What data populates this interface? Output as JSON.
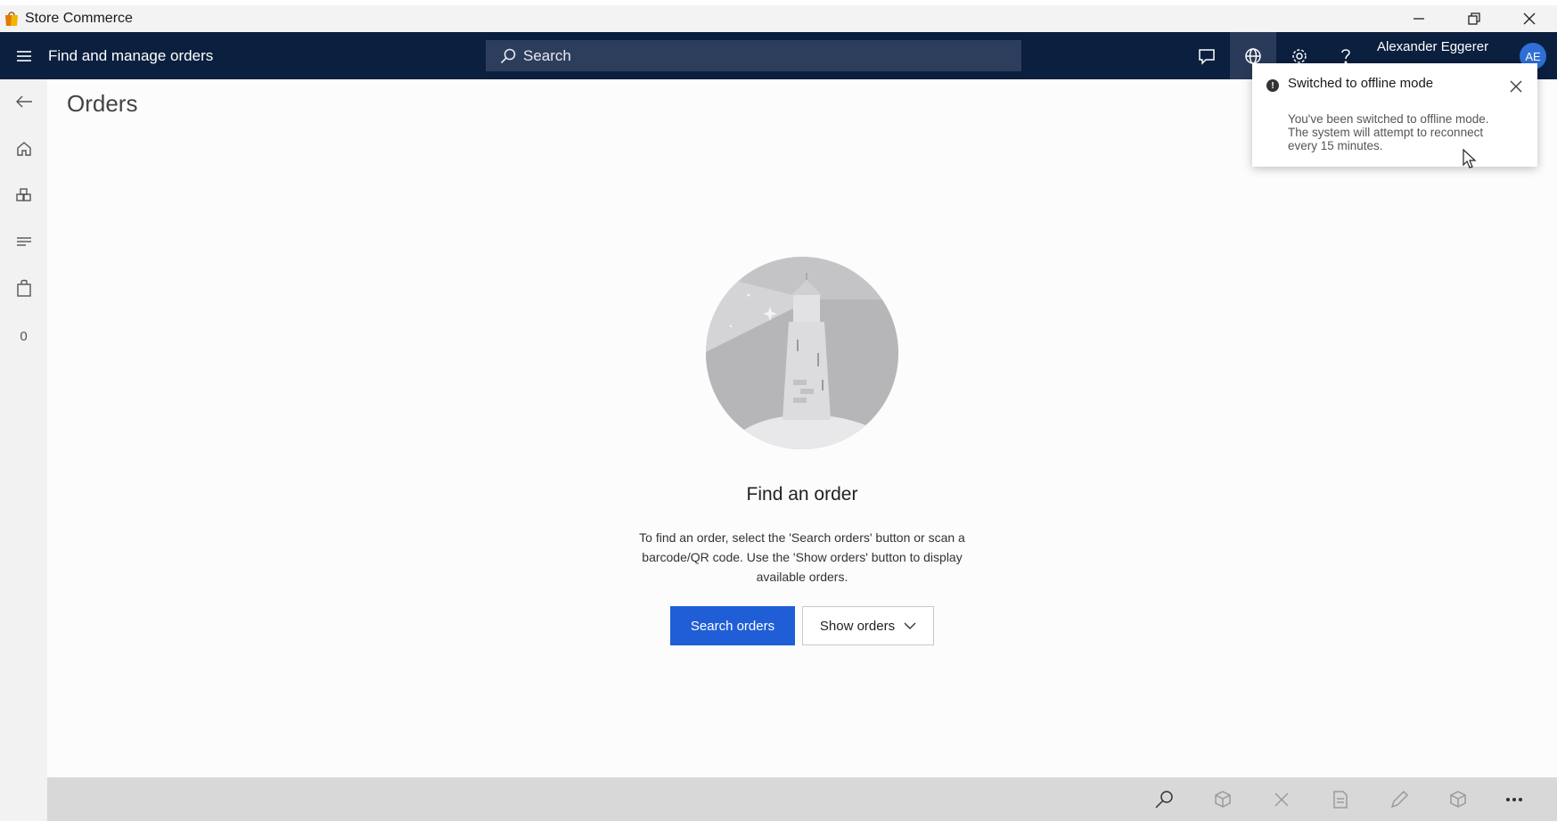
{
  "window": {
    "app_title": "Store Commerce",
    "logo_icon": "store-bag-icon",
    "controls": [
      "minimize-icon",
      "restore-icon",
      "close-icon"
    ]
  },
  "topnav": {
    "title": "Find and manage orders",
    "search_placeholder": "Search",
    "user_name": "Alexander Eggerer",
    "avatar_initials": "AE",
    "icons": [
      "chat-icon",
      "globe-icon",
      "gear-icon",
      "help-icon"
    ]
  },
  "leftrail": {
    "items": [
      "back-arrow-icon",
      "home-icon",
      "products-icon",
      "menu-lines-icon",
      "shopping-bag-icon"
    ],
    "cart_count": "0"
  },
  "main": {
    "page_title": "Orders",
    "empty_title": "Find an order",
    "empty_description": "To find an order, select the 'Search orders' button or scan a barcode/QR code. Use the 'Show orders' button to display available orders.",
    "primary_button": "Search orders",
    "secondary_button": "Show orders"
  },
  "toast": {
    "title": "Switched to offline mode",
    "body": "You've been switched to offline mode. The system will attempt to reconnect every 15 minutes."
  },
  "appbar": {
    "buttons": [
      "search-icon",
      "add-package-icon",
      "cancel-icon",
      "document-icon",
      "edit-icon",
      "package-icon",
      "more-icon"
    ]
  },
  "colors": {
    "nav_bg": "#0b1f3f",
    "primary": "#1f5ed6",
    "appbar_bg": "#d8d8d8"
  }
}
